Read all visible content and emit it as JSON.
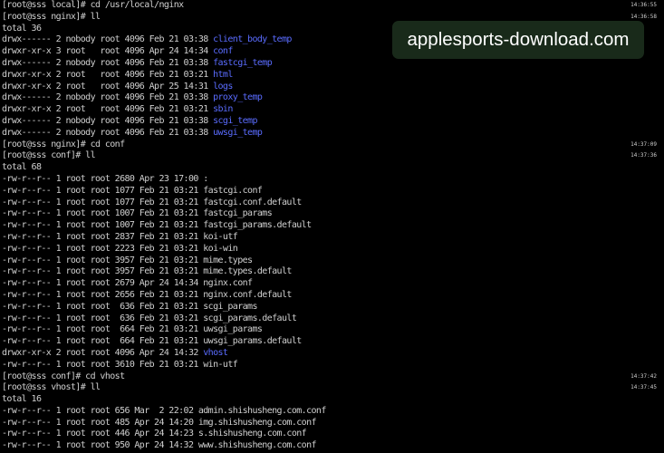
{
  "watermark": {
    "text": "applesports-download.com"
  },
  "lines": [
    {
      "text": "[root@sss local]# cd /usr/local/nginx",
      "time": "14:36:55"
    },
    {
      "text": "[root@sss nginx]# ll",
      "time": "14:36:58"
    },
    {
      "text": "total 36"
    },
    {
      "text": "drwx------ 2 nobody root 4096 Feb 21 03:38 ",
      "name": "client_body_temp",
      "dir": true
    },
    {
      "text": "drwxr-xr-x 3 root   root 4096 Apr 24 14:34 ",
      "name": "conf",
      "dir": true
    },
    {
      "text": "drwx------ 2 nobody root 4096 Feb 21 03:38 ",
      "name": "fastcgi_temp",
      "dir": true
    },
    {
      "text": "drwxr-xr-x 2 root   root 4096 Feb 21 03:21 ",
      "name": "html",
      "dir": true
    },
    {
      "text": "drwxr-xr-x 2 root   root 4096 Apr 25 14:31 ",
      "name": "logs",
      "dir": true
    },
    {
      "text": "drwx------ 2 nobody root 4096 Feb 21 03:38 ",
      "name": "proxy_temp",
      "dir": true
    },
    {
      "text": "drwxr-xr-x 2 root   root 4096 Feb 21 03:21 ",
      "name": "sbin",
      "dir": true
    },
    {
      "text": "drwx------ 2 nobody root 4096 Feb 21 03:38 ",
      "name": "scgi_temp",
      "dir": true
    },
    {
      "text": "drwx------ 2 nobody root 4096 Feb 21 03:38 ",
      "name": "uwsgi_temp",
      "dir": true
    },
    {
      "text": "[root@sss nginx]# cd conf",
      "time": "14:37:09"
    },
    {
      "text": "[root@sss conf]# ll",
      "time": "14:37:36"
    },
    {
      "text": "total 68"
    },
    {
      "text": "-rw-r--r-- 1 root root 2680 Apr 23 17:00 ",
      "name": ":"
    },
    {
      "text": "-rw-r--r-- 1 root root 1077 Feb 21 03:21 ",
      "name": "fastcgi.conf"
    },
    {
      "text": "-rw-r--r-- 1 root root 1077 Feb 21 03:21 ",
      "name": "fastcgi.conf.default"
    },
    {
      "text": "-rw-r--r-- 1 root root 1007 Feb 21 03:21 ",
      "name": "fastcgi_params"
    },
    {
      "text": "-rw-r--r-- 1 root root 1007 Feb 21 03:21 ",
      "name": "fastcgi_params.default"
    },
    {
      "text": "-rw-r--r-- 1 root root 2837 Feb 21 03:21 ",
      "name": "koi-utf"
    },
    {
      "text": "-rw-r--r-- 1 root root 2223 Feb 21 03:21 ",
      "name": "koi-win"
    },
    {
      "text": "-rw-r--r-- 1 root root 3957 Feb 21 03:21 ",
      "name": "mime.types"
    },
    {
      "text": "-rw-r--r-- 1 root root 3957 Feb 21 03:21 ",
      "name": "mime.types.default"
    },
    {
      "text": "-rw-r--r-- 1 root root 2679 Apr 24 14:34 ",
      "name": "nginx.conf"
    },
    {
      "text": "-rw-r--r-- 1 root root 2656 Feb 21 03:21 ",
      "name": "nginx.conf.default"
    },
    {
      "text": "-rw-r--r-- 1 root root  636 Feb 21 03:21 ",
      "name": "scgi_params"
    },
    {
      "text": "-rw-r--r-- 1 root root  636 Feb 21 03:21 ",
      "name": "scgi_params.default"
    },
    {
      "text": "-rw-r--r-- 1 root root  664 Feb 21 03:21 ",
      "name": "uwsgi_params"
    },
    {
      "text": "-rw-r--r-- 1 root root  664 Feb 21 03:21 ",
      "name": "uwsgi_params.default"
    },
    {
      "text": "drwxr-xr-x 2 root root 4096 Apr 24 14:32 ",
      "name": "vhost",
      "dir": true
    },
    {
      "text": "-rw-r--r-- 1 root root 3610 Feb 21 03:21 ",
      "name": "win-utf"
    },
    {
      "text": "[root@sss conf]# cd vhost",
      "time": "14:37:42"
    },
    {
      "text": "[root@sss vhost]# ll",
      "time": "14:37:45"
    },
    {
      "text": "total 16"
    },
    {
      "text": "-rw-r--r-- 1 root root 656 Mar  2 22:02 ",
      "name": "admin.shishusheng.com.conf"
    },
    {
      "text": "-rw-r--r-- 1 root root 485 Apr 24 14:20 ",
      "name": "img.shishusheng.com.conf"
    },
    {
      "text": "-rw-r--r-- 1 root root 446 Apr 24 14:23 ",
      "name": "s.shishusheng.com.conf"
    },
    {
      "text": "-rw-r--r-- 1 root root 950 Apr 24 14:32 ",
      "name": "www.shishusheng.com.conf"
    }
  ],
  "colors": {
    "background": "#000000",
    "text": "#cfcfcf",
    "directory": "#5a6cff",
    "watermark_bg": "#1c301e"
  }
}
